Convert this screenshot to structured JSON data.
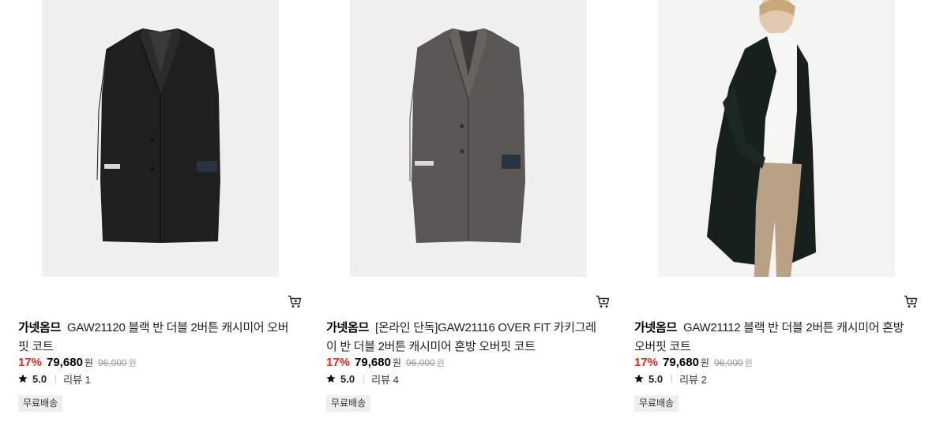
{
  "products": [
    {
      "brand": "가넷옴므",
      "name": "GAW21120 블랙 반 더블 2버튼 캐시미어 오버핏 코트",
      "discount": "17%",
      "price": "79,680",
      "currency": "원",
      "original_price": "96,000",
      "rating": "5.0",
      "reviews": "리뷰 1",
      "badge": "무료배송",
      "image": "black-coat-flat",
      "coat_color": "#1f1f1f"
    },
    {
      "brand": "가넷옴므",
      "name": "[온라인 단독]GAW21116 OVER FIT 카키그레이 반 더블 2버튼 캐시미어 혼방 오버핏 코트",
      "discount": "17%",
      "price": "79,680",
      "currency": "원",
      "original_price": "96,000",
      "rating": "5.0",
      "reviews": "리뷰 4",
      "badge": "무료배송",
      "image": "khaki-gray-coat-flat",
      "coat_color": "#5a5755"
    },
    {
      "brand": "가넷옴므",
      "name": "GAW21112 블랙 반 더블 2버튼 캐시미어 혼방 오버핏 코트",
      "discount": "17%",
      "price": "79,680",
      "currency": "원",
      "original_price": "96,000",
      "rating": "5.0",
      "reviews": "리뷰 2",
      "badge": "무료배송",
      "image": "model-wearing-dark-coat",
      "coat_color": "#16201d"
    }
  ],
  "icons": {
    "cart": "cart-icon",
    "star": "star-icon"
  },
  "colors": {
    "discount": "#e8251f",
    "badge_bg": "#eeeeee",
    "image_bg": "#f0f0f0"
  }
}
